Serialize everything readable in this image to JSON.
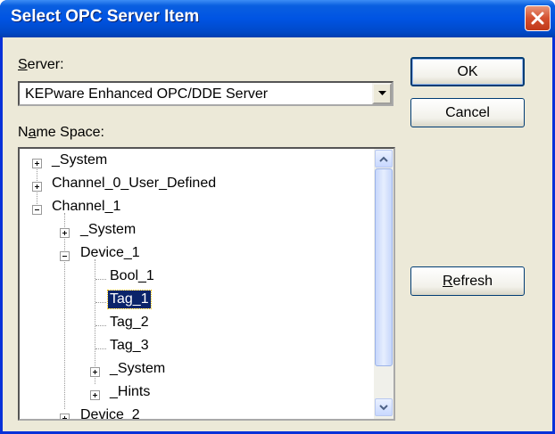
{
  "window": {
    "title": "Select OPC Server Item"
  },
  "server": {
    "label_accel": "S",
    "label_rest": "erver:",
    "value": "KEPware Enhanced OPC/DDE Server"
  },
  "namespace": {
    "label_pre": "N",
    "label_accel": "a",
    "label_rest": "me Space:"
  },
  "tree": {
    "items": [
      {
        "label": "_System"
      },
      {
        "label": "Channel_0_User_Defined"
      },
      {
        "label": "Channel_1"
      },
      {
        "label": "_System"
      },
      {
        "label": "Device_1"
      },
      {
        "label": "Bool_1"
      },
      {
        "label": "Tag_1",
        "selected": true
      },
      {
        "label": "Tag_2"
      },
      {
        "label": "Tag_3"
      },
      {
        "label": "_System"
      },
      {
        "label": "_Hints"
      },
      {
        "label": "Device_2"
      }
    ]
  },
  "buttons": {
    "ok": "OK",
    "cancel": "Cancel",
    "refresh_accel": "R",
    "refresh_rest": "efresh"
  },
  "icons": {
    "close": "close-icon",
    "dropdown": "chevron-down-icon",
    "scroll_up": "chevron-up-icon",
    "scroll_down": "chevron-down-icon"
  },
  "colors": {
    "titlebar": "#0054e3",
    "selection": "#0a246a",
    "close": "#d4502f",
    "dialog": "#ece9d8"
  }
}
